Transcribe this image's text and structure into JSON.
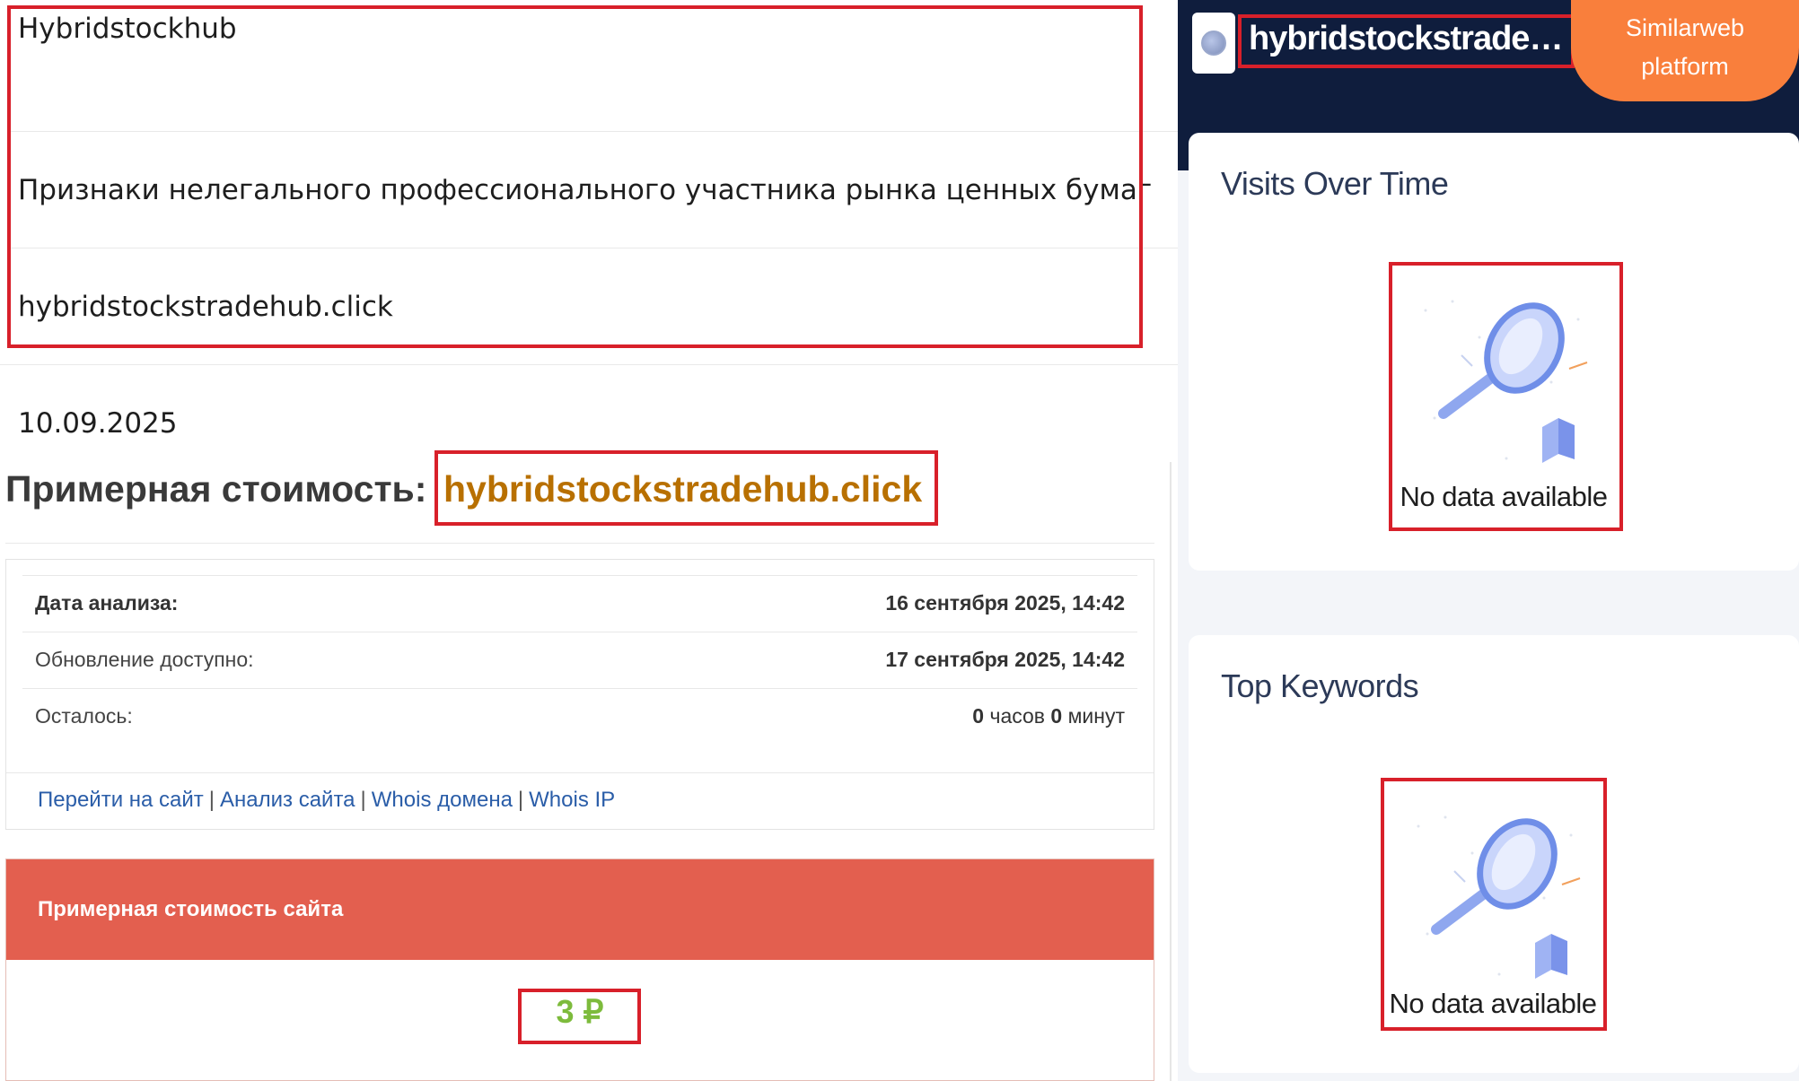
{
  "left": {
    "site_name": "Hybridstockhub",
    "warning": "Признаки нелегального профессионального участника рынка ценных бумаг",
    "domain_line": "hybridstockstradehub.click",
    "date": "10.09.2025",
    "price_title": "Примерная стоимость:",
    "price_domain": "hybridstockstradehub.click",
    "analysis": {
      "rows": [
        {
          "label": "Дата анализа:",
          "value": "16 сентября 2025, 14:42"
        },
        {
          "label": "Обновление доступно:",
          "value": "17 сентября 2025, 14:42"
        },
        {
          "label": "Осталось:",
          "hours": "0",
          "hours_unit": "часов",
          "minutes": "0",
          "minutes_unit": "минут"
        }
      ],
      "links": [
        "Перейти на сайт",
        "Анализ сайта",
        "Whois домена",
        "Whois IP"
      ],
      "link_separator": "|"
    },
    "cost": {
      "header": "Примерная стоимость сайта",
      "value": "3 ₽"
    }
  },
  "right": {
    "domain": "hybridstockstradehub.click",
    "platform_button": [
      "Similarweb",
      "platform"
    ],
    "cards": [
      {
        "title": "Visits Over Time",
        "empty_text": "No data available"
      },
      {
        "title": "Top Keywords",
        "empty_text": "No data available"
      }
    ]
  },
  "colors": {
    "highlight_border": "#d8202a",
    "price_domain": "#b87000",
    "cost_header": "#e35f4f",
    "cost_value": "#7dbb3c",
    "link": "#2a5da8",
    "right_header_bg": "#0f1d3d",
    "platform_button": "#f97f3c"
  },
  "icons": [
    "globe-icon",
    "magnifier-illustration"
  ]
}
